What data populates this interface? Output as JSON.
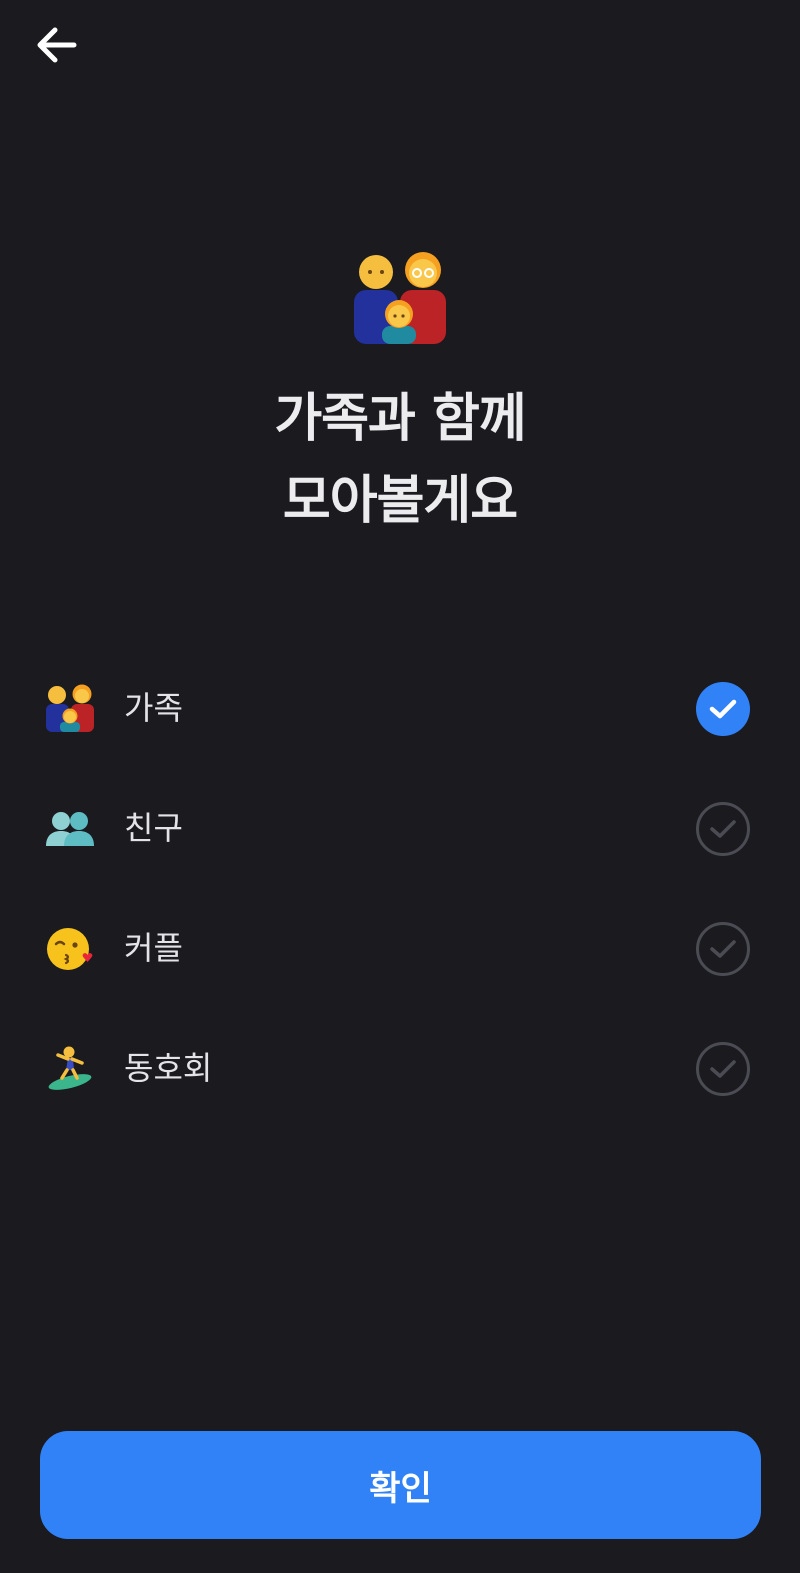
{
  "header": {
    "back_icon": "arrow-left-icon"
  },
  "hero": {
    "icon": "family-emoji",
    "title_line1": "가족과 함께",
    "title_line2": "모아볼게요"
  },
  "options": [
    {
      "icon": "family-emoji",
      "label": "가족",
      "selected": true
    },
    {
      "icon": "people-emoji",
      "label": "친구",
      "selected": false
    },
    {
      "icon": "kissing-face-emoji",
      "label": "커플",
      "selected": false
    },
    {
      "icon": "surfer-emoji",
      "label": "동호회",
      "selected": false
    }
  ],
  "colors": {
    "background": "#1a1a1f",
    "accent": "#3182f6",
    "check_off": "#4b4b54",
    "text": "#ececef"
  },
  "confirm": {
    "label": "확인"
  }
}
